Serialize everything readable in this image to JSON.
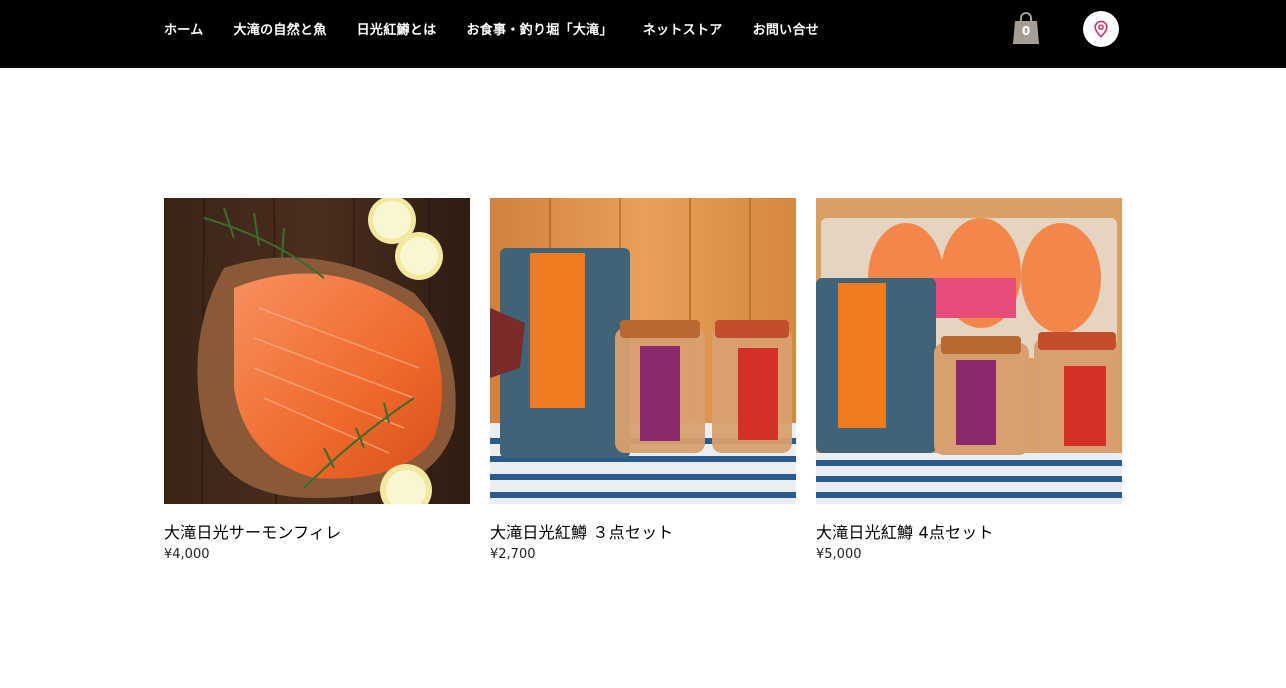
{
  "header": {
    "nav": [
      {
        "label": "ホーム"
      },
      {
        "label": "大滝の自然と魚"
      },
      {
        "label": "日光紅鱒とは"
      },
      {
        "label": "お食事・釣り堀「大滝」"
      },
      {
        "label": "ネットストア"
      },
      {
        "label": "お問い合せ"
      }
    ],
    "cart_count": "0",
    "icons": {
      "cart": "shopping-bag-icon",
      "map": "map-pin-icon"
    },
    "colors": {
      "bar": "#000000",
      "cart": "#a69e94",
      "pin": "#c8336a"
    }
  },
  "products": [
    {
      "name": "大滝日光サーモンフィレ",
      "price": "¥4,000"
    },
    {
      "name": "大滝日光紅鱒 ３点セット",
      "price": "¥2,700"
    },
    {
      "name": "大滝日光紅鱒 4点セット",
      "price": "¥5,000"
    }
  ]
}
